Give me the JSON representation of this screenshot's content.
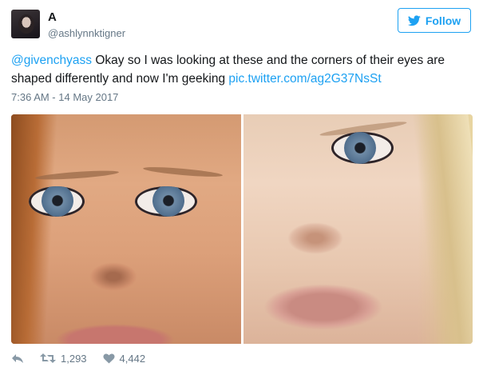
{
  "author": {
    "display_name": "A",
    "handle": "@ashlynnktigner"
  },
  "follow_button": {
    "label": "Follow",
    "icon": "twitter-bird-icon",
    "color": "#1da1f2"
  },
  "tweet": {
    "mention": "@givenchyass",
    "text": " Okay so I was looking at these and the corners of their eyes are shaped differently and now I'm geeking ",
    "link": "pic.twitter.com/ag2G37NsSt",
    "timestamp": "7:36 AM - 14 May 2017"
  },
  "media": {
    "images": [
      {
        "name": "face-photo-left"
      },
      {
        "name": "face-photo-right"
      }
    ]
  },
  "actions": {
    "reply_icon": "reply-icon",
    "retweet_icon": "retweet-icon",
    "retweet_count": "1,293",
    "like_icon": "heart-icon",
    "like_count": "4,442"
  },
  "colors": {
    "link": "#1da1f2",
    "secondary_text": "#657786",
    "primary_text": "#14171a"
  }
}
